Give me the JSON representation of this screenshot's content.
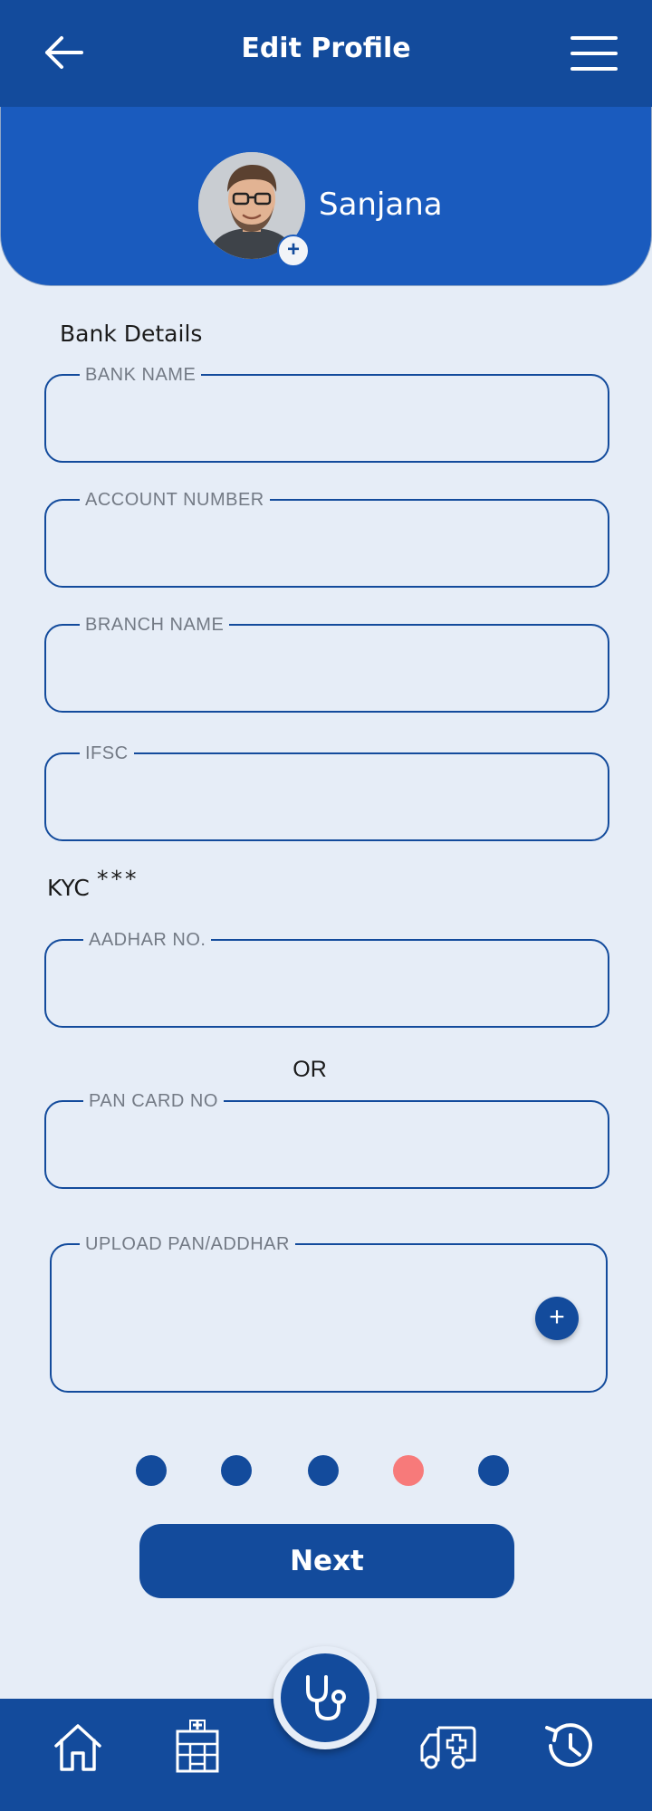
{
  "header": {
    "title": "Edit Profile"
  },
  "profile": {
    "name": "Sanjana"
  },
  "bank": {
    "section_title": "Bank Details",
    "bank_name_label": "BANK NAME",
    "account_number_label": "ACCOUNT NUMBER",
    "branch_name_label": "BRANCH NAME",
    "ifsc_label": "IFSC"
  },
  "kyc": {
    "section_title": "KYC",
    "required_mark": "***",
    "aadhar_label": "AADHAR NO.",
    "or_text": "OR",
    "pan_label": "PAN CARD NO",
    "upload_label": "UPLOAD PAN/ADDHAR"
  },
  "pagination": {
    "total": 5,
    "current": 4
  },
  "actions": {
    "next_label": "Next"
  },
  "colors": {
    "primary": "#134b9c",
    "panel": "#1a5bbe",
    "background": "#e6edf7",
    "active_dot": "#f77a7a"
  },
  "icons": {
    "back": "back-arrow-icon",
    "menu": "hamburger-menu-icon",
    "home": "home-icon",
    "hospital": "hospital-icon",
    "stethoscope": "stethoscope-icon",
    "ambulance": "ambulance-icon",
    "history": "history-icon"
  }
}
